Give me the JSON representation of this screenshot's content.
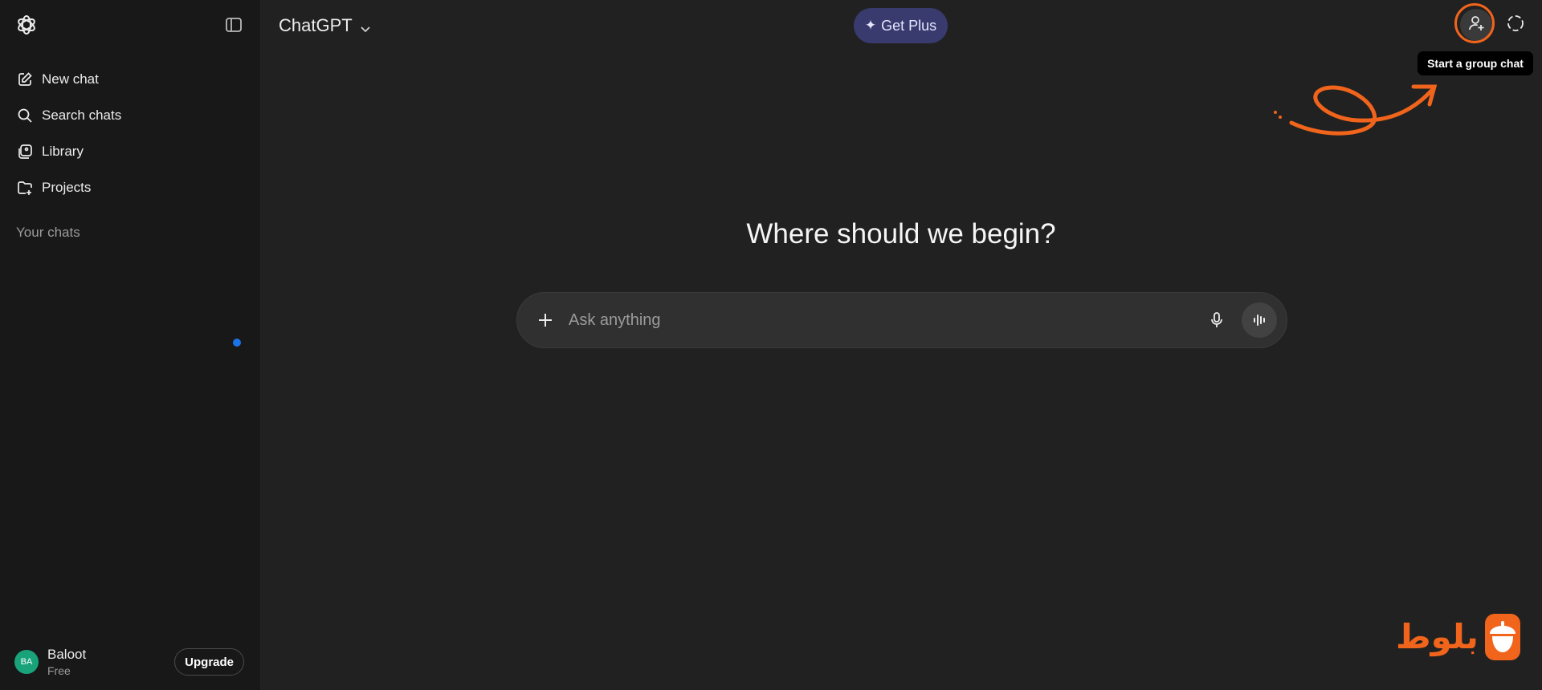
{
  "sidebar": {
    "logo_icon": "openai-logo-icon",
    "toggle_icon": "sidebar-toggle-icon",
    "nav": [
      {
        "label": "New chat",
        "icon": "edit-icon"
      },
      {
        "label": "Search chats",
        "icon": "search-icon"
      },
      {
        "label": "Library",
        "icon": "library-icon"
      },
      {
        "label": "Projects",
        "icon": "folder-plus-icon"
      }
    ],
    "section_label": "Your chats",
    "account": {
      "initials": "BA",
      "name": "Baloot",
      "plan": "Free",
      "upgrade_label": "Upgrade"
    }
  },
  "header": {
    "model_label": "ChatGPT",
    "get_plus_label": "Get Plus",
    "group_chat_tooltip": "Start a group chat"
  },
  "main": {
    "headline": "Where should we begin?",
    "composer_placeholder": "Ask anything"
  },
  "watermark": {
    "text": "بلوط"
  },
  "colors": {
    "background": "#212121",
    "sidebar": "#181818",
    "accent_orange": "#f0641c",
    "get_plus_bg": "#393b6e",
    "avatar": "#19a37a",
    "blue_dot": "#1a73e8"
  }
}
